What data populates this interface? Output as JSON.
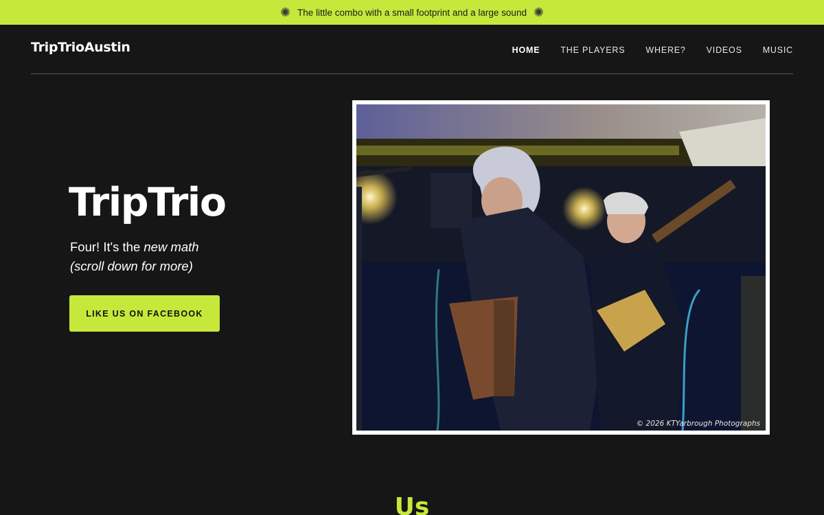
{
  "announcement": {
    "text": "The little combo with a small footprint and a large sound",
    "left_icon": "starburst-icon",
    "right_icon": "starburst-icon"
  },
  "header": {
    "brand": "TripTrioAustin",
    "nav": [
      {
        "label": "HOME",
        "active": true
      },
      {
        "label": "THE PLAYERS",
        "active": false
      },
      {
        "label": "WHERE?",
        "active": false
      },
      {
        "label": "VIDEOS",
        "active": false
      },
      {
        "label": "MUSIC",
        "active": false
      }
    ]
  },
  "hero": {
    "title": "TripTrio",
    "tagline_lead": "Four! It's the ",
    "tagline_em": "new math",
    "tagline_line2": "(scroll down for more)",
    "button_label": "LIKE US ON FACEBOOK",
    "photo_credit": "© 2026 KTYarbrough Photographs"
  },
  "next_section": {
    "heading": "Us"
  },
  "colors": {
    "accent": "#c6e83b",
    "background": "#161616",
    "text": "#ffffff"
  }
}
